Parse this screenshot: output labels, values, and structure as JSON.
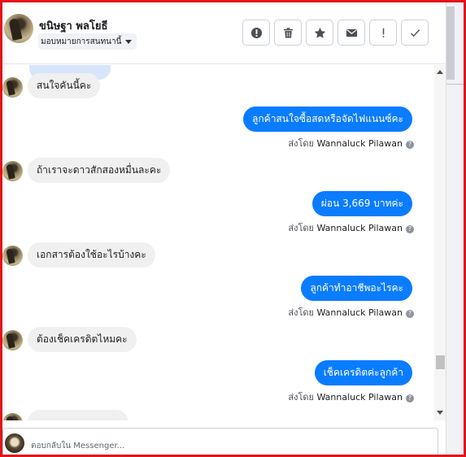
{
  "header": {
    "contact_name": "ขนิษฐา พลโยธี",
    "assign_label": "มอบหมายการสนทนานี้",
    "actions": [
      {
        "icon": "alert-circle-icon"
      },
      {
        "icon": "trash-icon"
      },
      {
        "icon": "star-icon"
      },
      {
        "icon": "envelope-icon"
      },
      {
        "icon": "exclamation-icon"
      },
      {
        "icon": "check-icon"
      }
    ]
  },
  "thread": {
    "sent_by_prefix": "ส่งโดย",
    "messages": [
      {
        "dir": "in",
        "text": "สนใจคันนี้คะ"
      },
      {
        "dir": "out",
        "text": "ลูกค้าสนใจซื้อสดหรือจัดไฟแนนซ์คะ",
        "sender": "Wannaluck Pilawan"
      },
      {
        "dir": "in",
        "text": "ถ้าเราจะดาวสักสองหมื่นละคะ"
      },
      {
        "dir": "out",
        "text": "ผ่อน 3,669  บาทค่ะ",
        "sender": "Wannaluck Pilawan"
      },
      {
        "dir": "in",
        "text": "เอกสารต้องใช้อะไรบ้างคะ"
      },
      {
        "dir": "out",
        "text": "ลูกค้าทำอาชีพอะไรคะ",
        "sender": "Wannaluck Pilawan"
      },
      {
        "dir": "in",
        "text": "ต้องเช็คเครดิตไหมคะ"
      },
      {
        "dir": "out",
        "text": "เช็คเครดิตค่ะลูกค้า",
        "sender": "Wannaluck Pilawan"
      }
    ]
  },
  "composer": {
    "placeholder": "ตอบกลับใน Messenger..."
  },
  "colors": {
    "outgoing_bubble": "#0a7cff",
    "incoming_bubble": "#f0f0f0",
    "frame": "#e4121b"
  }
}
